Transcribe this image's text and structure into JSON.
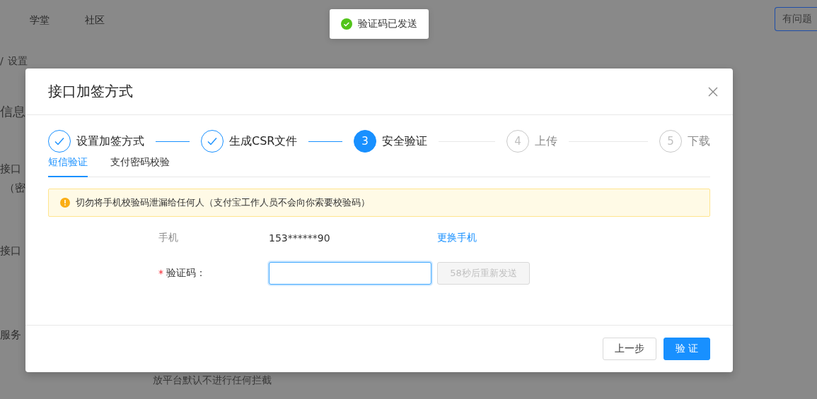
{
  "background_page": {
    "nav": [
      "学堂",
      "社区"
    ],
    "help_button": "有问题",
    "breadcrumb_separator": "/",
    "breadcrumb": "设置",
    "section_title": "信息",
    "labels": [
      "接口",
      "（密",
      "接口",
      "服务"
    ],
    "hint": "放平台默认不进行任何拦截"
  },
  "toast": {
    "message": "验证码已发送"
  },
  "modal": {
    "title": "接口加签方式",
    "steps": [
      {
        "title": "设置加签方式",
        "finished": true,
        "current": false
      },
      {
        "title": "生成CSR文件",
        "finished": true,
        "current": false
      },
      {
        "number": "3",
        "title": "安全验证",
        "finished": false,
        "current": true
      },
      {
        "number": "4",
        "title": "上传",
        "finished": false,
        "current": false
      },
      {
        "number": "5",
        "title": "下载",
        "finished": false,
        "current": false
      }
    ],
    "tabs": [
      {
        "label": "短信验证",
        "selected": true
      },
      {
        "label": "支付密码校验",
        "selected": false
      }
    ],
    "alert": {
      "text": "切勿将手机校验码泄漏给任何人（支付宝工作人员不会向你索要校验码）"
    },
    "phone": {
      "label": "手机",
      "value": "153******90",
      "link": "更换手机"
    },
    "code": {
      "required_mark": "*",
      "label": "验证码：",
      "focused": true,
      "resend": "58秒后重新发送",
      "resend_disabled": true
    },
    "buttons": [
      {
        "label": "上一步",
        "kind": "default"
      },
      {
        "label": "验 证",
        "kind": "primary"
      }
    ]
  }
}
